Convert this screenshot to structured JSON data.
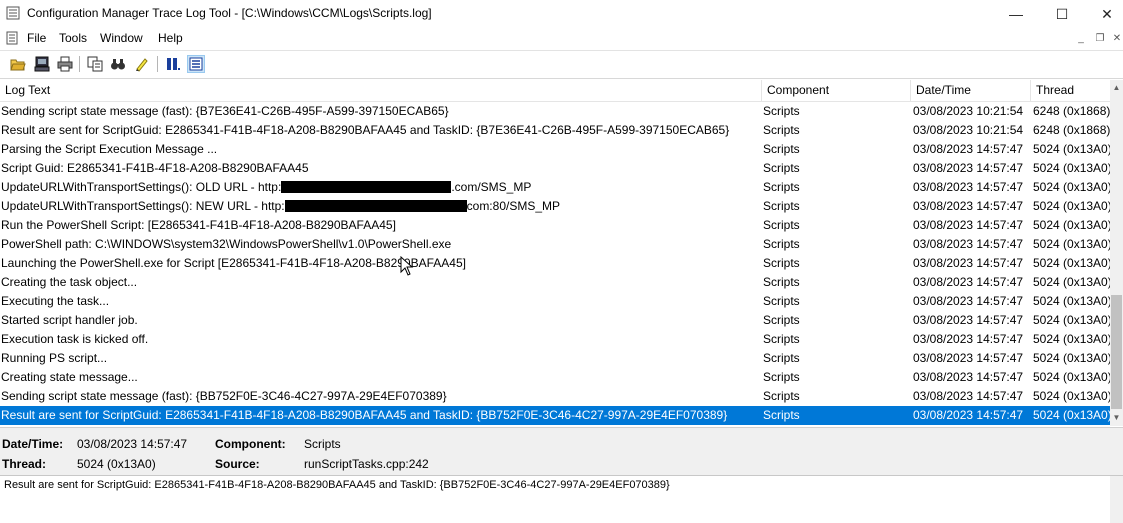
{
  "window": {
    "title": "Configuration Manager Trace Log Tool - [C:\\Windows\\CCM\\Logs\\Scripts.log]",
    "controls": {
      "minimize": "—",
      "maximize": "☐",
      "close": "✕"
    }
  },
  "menu": {
    "items": [
      "File",
      "Tools",
      "Window",
      "Help"
    ],
    "mdi": {
      "minimize": "_",
      "restore": "❐",
      "close": "✕"
    }
  },
  "toolbar": {
    "buttons": [
      "open-icon",
      "print-preview-icon",
      "print-icon",
      "copy-icon",
      "find-icon",
      "highlight-icon",
      "pause-icon",
      "error-lookup-icon"
    ]
  },
  "columns": {
    "log_text": "Log Text",
    "component": "Component",
    "datetime": "Date/Time",
    "thread": "Thread"
  },
  "rows": [
    {
      "text": "Sending script state message (fast): {B7E36E41-C26B-495F-A599-397150ECAB65}",
      "component": "Scripts",
      "datetime": "03/08/2023 10:21:54",
      "thread": "6248 (0x1868)"
    },
    {
      "text": "Result are sent for ScriptGuid: E2865341-F41B-4F18-A208-B8290BAFAA45 and TaskID: {B7E36E41-C26B-495F-A599-397150ECAB65}",
      "component": "Scripts",
      "datetime": "03/08/2023 10:21:54",
      "thread": "6248 (0x1868)"
    },
    {
      "text": "Parsing the Script Execution Message ...",
      "component": "Scripts",
      "datetime": "03/08/2023 14:57:47",
      "thread": "5024 (0x13A0)"
    },
    {
      "text": "Script Guid: E2865341-F41B-4F18-A208-B8290BAFAA45",
      "component": "Scripts",
      "datetime": "03/08/2023 14:57:47",
      "thread": "5024 (0x13A0)"
    },
    {
      "text_prefix": "UpdateURLWithTransportSettings(): OLD URL - http:",
      "text_suffix": ".com/SMS_MP",
      "component": "Scripts",
      "datetime": "03/08/2023 14:57:47",
      "thread": "5024 (0x13A0)"
    },
    {
      "text_prefix": "UpdateURLWithTransportSettings(): NEW URL - http:",
      "text_suffix": "com:80/SMS_MP",
      "component": "Scripts",
      "datetime": "03/08/2023 14:57:47",
      "thread": "5024 (0x13A0)"
    },
    {
      "text": "Run the PowerShell Script: [E2865341-F41B-4F18-A208-B8290BAFAA45]",
      "component": "Scripts",
      "datetime": "03/08/2023 14:57:47",
      "thread": "5024 (0x13A0)"
    },
    {
      "text": "PowerShell path: C:\\WINDOWS\\system32\\WindowsPowerShell\\v1.0\\PowerShell.exe",
      "component": "Scripts",
      "datetime": "03/08/2023 14:57:47",
      "thread": "5024 (0x13A0)"
    },
    {
      "text": "Launching the PowerShell.exe for Script [E2865341-F41B-4F18-A208-B8290BAFAA45]",
      "component": "Scripts",
      "datetime": "03/08/2023 14:57:47",
      "thread": "5024 (0x13A0)"
    },
    {
      "text": "Creating the task object...",
      "component": "Scripts",
      "datetime": "03/08/2023 14:57:47",
      "thread": "5024 (0x13A0)"
    },
    {
      "text": "Executing the task...",
      "component": "Scripts",
      "datetime": "03/08/2023 14:57:47",
      "thread": "5024 (0x13A0)"
    },
    {
      "text": "Started script handler job.",
      "component": "Scripts",
      "datetime": "03/08/2023 14:57:47",
      "thread": "5024 (0x13A0)"
    },
    {
      "text": "Execution task is kicked off.",
      "component": "Scripts",
      "datetime": "03/08/2023 14:57:47",
      "thread": "5024 (0x13A0)"
    },
    {
      "text": "Running PS script...",
      "component": "Scripts",
      "datetime": "03/08/2023 14:57:47",
      "thread": "5024 (0x13A0)"
    },
    {
      "text": "Creating state message...",
      "component": "Scripts",
      "datetime": "03/08/2023 14:57:47",
      "thread": "5024 (0x13A0)"
    },
    {
      "text": "Sending script state message (fast): {BB752F0E-3C46-4C27-997A-29E4EF070389}",
      "component": "Scripts",
      "datetime": "03/08/2023 14:57:47",
      "thread": "5024 (0x13A0)"
    },
    {
      "text": "Result are sent for ScriptGuid: E2865341-F41B-4F18-A208-B8290BAFAA45 and TaskID: {BB752F0E-3C46-4C27-997A-29E4EF070389}",
      "component": "Scripts",
      "datetime": "03/08/2023 14:57:47",
      "thread": "5024 (0x13A0)",
      "selected": true
    }
  ],
  "details": {
    "datetime_label": "Date/Time:",
    "datetime_value": "03/08/2023 14:57:47",
    "component_label": "Component:",
    "component_value": "Scripts",
    "thread_label": "Thread:",
    "thread_value": "5024 (0x13A0)",
    "source_label": "Source:",
    "source_value": "runScriptTasks.cpp:242"
  },
  "message": "Result are sent for ScriptGuid: E2865341-F41B-4F18-A208-B8290BAFAA45 and TaskID: {BB752F0E-3C46-4C27-997A-29E4EF070389}",
  "colors": {
    "selection": "#0078d7",
    "panel": "#f0f0f0"
  }
}
